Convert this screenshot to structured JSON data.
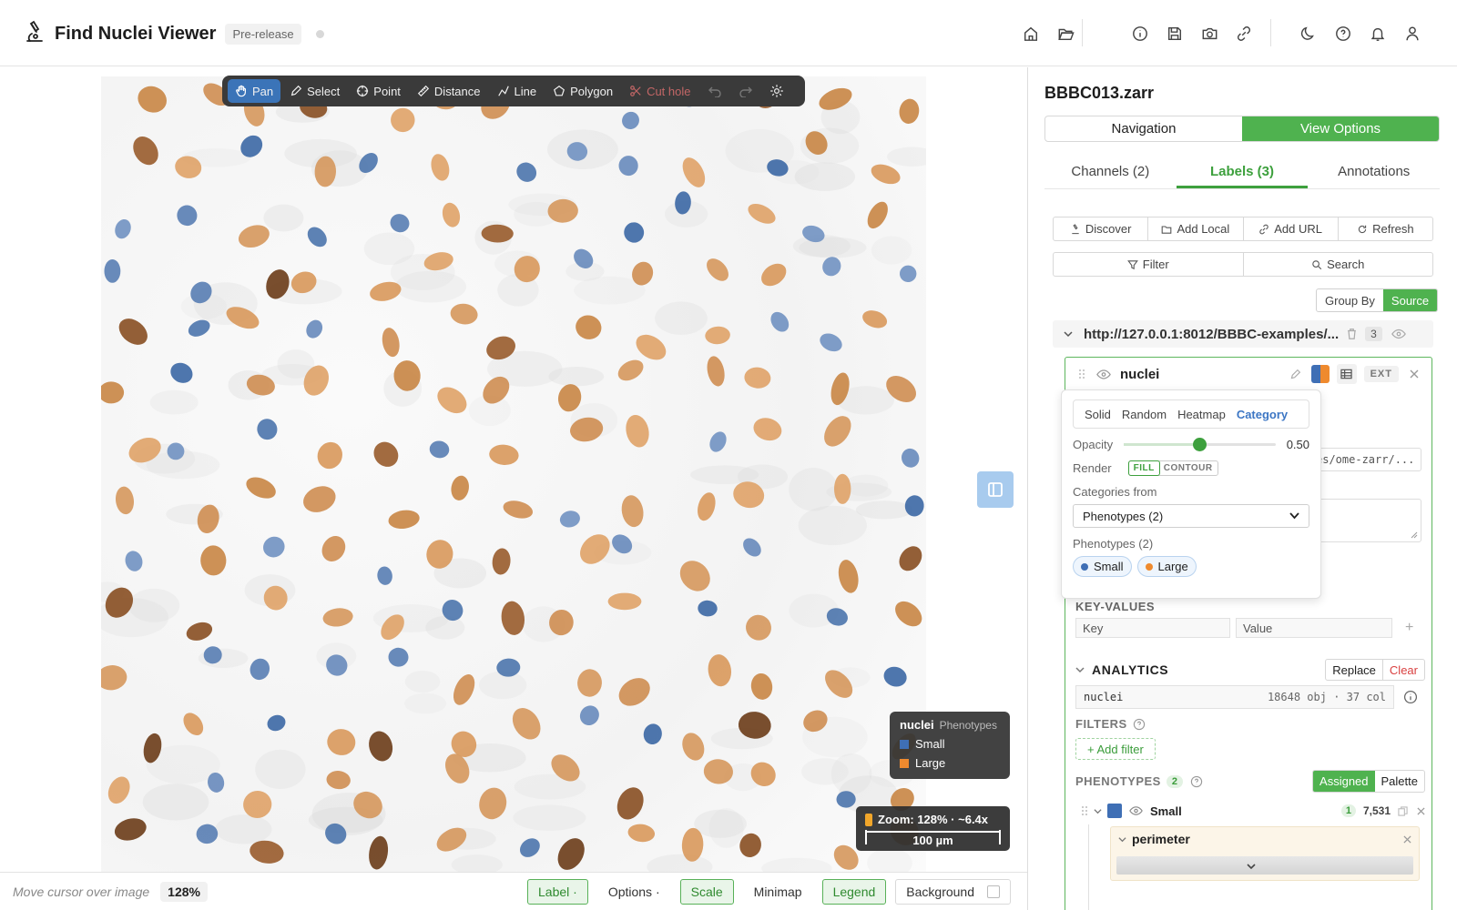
{
  "app": {
    "title": "Find Nuclei Viewer",
    "badge": "Pre-release"
  },
  "toolbar": {
    "pan": "Pan",
    "select": "Select",
    "point": "Point",
    "distance": "Distance",
    "line": "Line",
    "polygon": "Polygon",
    "cut_hole": "Cut hole"
  },
  "legend": {
    "layer": "nuclei",
    "subtitle": "Phenotypes",
    "items": [
      {
        "label": "Small",
        "color": "#3f6fb5"
      },
      {
        "label": "Large",
        "color": "#ef8a2e"
      }
    ]
  },
  "zoom": {
    "readout": "Zoom: 128% · ~6.4x",
    "scale": "100 µm"
  },
  "status": {
    "hint": "Move cursor over image",
    "zoom_pct": "128%",
    "label": "Label ·",
    "options": "Options ·",
    "scale": "Scale",
    "minimap": "Minimap",
    "legend": "Legend",
    "background": "Background"
  },
  "panel": {
    "title": "BBBC013.zarr",
    "modes": [
      "Navigation",
      "View Options"
    ],
    "tabs": [
      "Channels (2)",
      "Labels (3)",
      "Annotations"
    ],
    "actions": [
      "Discover",
      "Add Local",
      "Add URL",
      "Refresh"
    ],
    "filter": "Filter",
    "search": "Search",
    "group_by": "Group By",
    "group_source": "Source",
    "source_url": "http://127.0.0.1:8012/BBBC-examples/...",
    "source_count": "3",
    "layer_name": "nuclei",
    "ext": "EXT",
    "uri_text": "es/ome-zarr/...",
    "key_values": "KEY-VALUES",
    "key_placeholder": "Key",
    "value_placeholder": "Value",
    "analytics": "ANALYTICS",
    "replace": "Replace",
    "clear": "Clear",
    "analytics_name": "nuclei",
    "analytics_meta": "18648 obj · 37 col",
    "filters": "FILTERS",
    "add_filter": "+ Add filter",
    "phenotypes": "PHENOTYPES",
    "phenotypes_count": "2",
    "assigned": "Assigned",
    "palette": "Palette",
    "small_name": "Small",
    "small_n1": "1",
    "small_n2": "7,531",
    "perimeter": "perimeter"
  },
  "popover": {
    "modes": [
      "Solid",
      "Random",
      "Heatmap",
      "Category"
    ],
    "opacity_label": "Opacity",
    "opacity_value": "0.50",
    "opacity": 0.5,
    "render_label": "Render",
    "fill": "FILL",
    "contour": "CONTOUR",
    "categories_from": "Categories from",
    "select_value": "Phenotypes (2)",
    "phenotypes_label": "Phenotypes (2)",
    "pills": [
      {
        "label": "Small",
        "color": "#3f6fb5"
      },
      {
        "label": "Large",
        "color": "#ef8a2e"
      }
    ]
  }
}
